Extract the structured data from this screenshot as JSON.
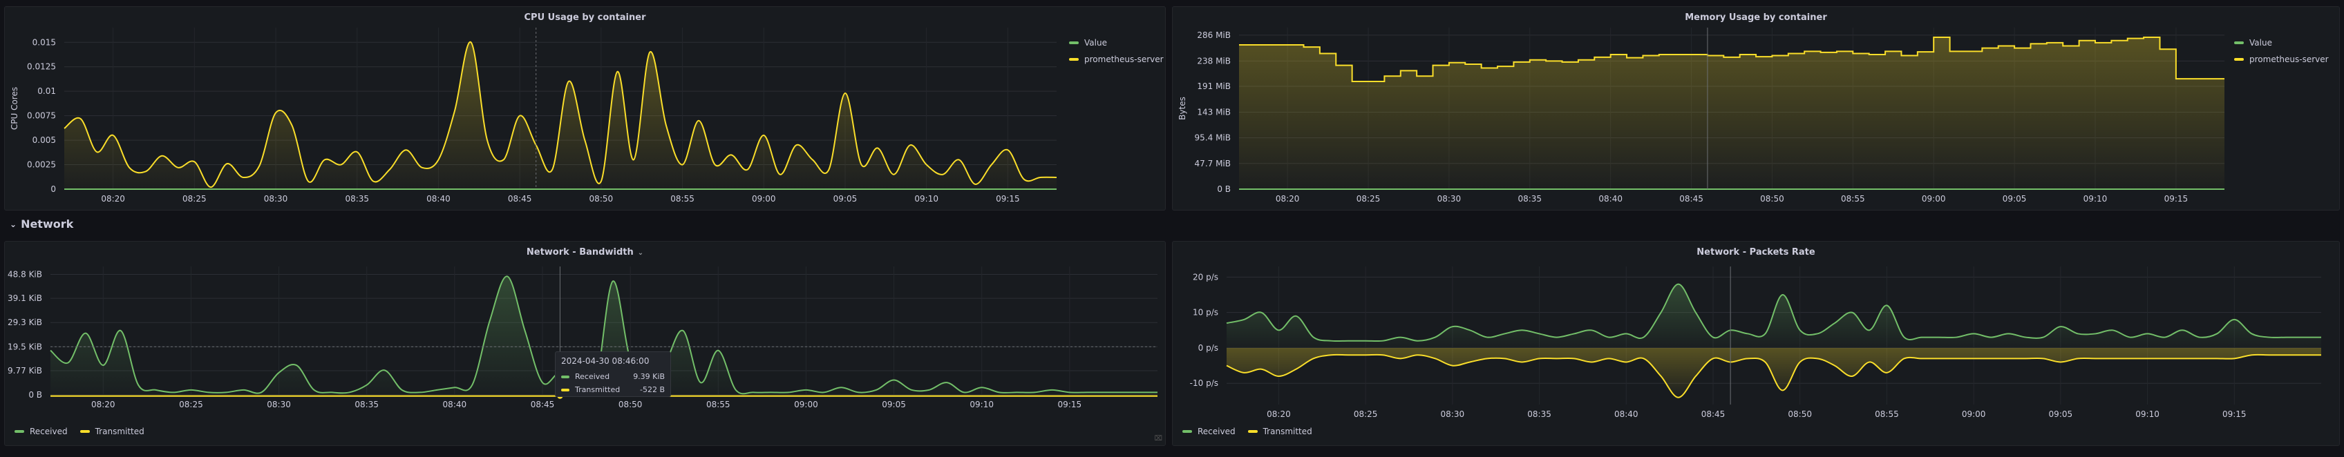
{
  "colors": {
    "green": "#73bf69",
    "yellow": "#fade2a",
    "background": "#111217",
    "panel": "#181b1f"
  },
  "network_row": {
    "title": "Network",
    "icon": "chevron-down-icon"
  },
  "chart_data": [
    {
      "id": "cpu",
      "type": "line",
      "title": "CPU Usage by container",
      "ylabel": "CPU Cores",
      "xticks": [
        "08:20",
        "08:25",
        "08:30",
        "08:35",
        "08:40",
        "08:45",
        "08:50",
        "08:55",
        "09:00",
        "09:05",
        "09:10",
        "09:15"
      ],
      "yticks": [
        "0",
        "0.0025",
        "0.005",
        "0.0075",
        "0.01",
        "0.0125",
        "0.015"
      ],
      "ylim": [
        0,
        0.0165
      ],
      "xlim": [
        "08:17",
        "09:18"
      ],
      "series": [
        {
          "name": "Value",
          "color": "#73bf69",
          "x": [
            "08:17",
            "09:18"
          ],
          "y": [
            0,
            0
          ]
        },
        {
          "name": "prometheus-server",
          "color": "#fade2a",
          "x": [
            "08:17",
            "08:18",
            "08:19",
            "08:20",
            "08:21",
            "08:22",
            "08:23",
            "08:24",
            "08:25",
            "08:26",
            "08:27",
            "08:28",
            "08:29",
            "08:30",
            "08:31",
            "08:32",
            "08:33",
            "08:34",
            "08:35",
            "08:36",
            "08:37",
            "08:38",
            "08:39",
            "08:40",
            "08:41",
            "08:42",
            "08:43",
            "08:44",
            "08:45",
            "08:46",
            "08:47",
            "08:48",
            "08:49",
            "08:50",
            "08:51",
            "08:52",
            "08:53",
            "08:54",
            "08:55",
            "08:56",
            "08:57",
            "08:58",
            "08:59",
            "09:00",
            "09:01",
            "09:02",
            "09:03",
            "09:04",
            "09:05",
            "09:06",
            "09:07",
            "09:08",
            "09:09",
            "09:10",
            "09:11",
            "09:12",
            "09:13",
            "09:14",
            "09:15",
            "09:16",
            "09:17",
            "09:18"
          ],
          "y": [
            0.0062,
            0.0072,
            0.0038,
            0.0055,
            0.0022,
            0.0018,
            0.0034,
            0.0022,
            0.0028,
            0.0002,
            0.0026,
            0.0012,
            0.0024,
            0.0078,
            0.0065,
            0.0008,
            0.003,
            0.0025,
            0.0038,
            0.0008,
            0.002,
            0.004,
            0.0022,
            0.003,
            0.008,
            0.015,
            0.005,
            0.003,
            0.0075,
            0.0045,
            0.002,
            0.011,
            0.005,
            0.0008,
            0.012,
            0.003,
            0.014,
            0.0065,
            0.0025,
            0.007,
            0.0025,
            0.0035,
            0.002,
            0.0055,
            0.0015,
            0.0045,
            0.003,
            0.002,
            0.0098,
            0.0025,
            0.0042,
            0.0015,
            0.0045,
            0.0025,
            0.0015,
            0.003,
            0.0005,
            0.0025,
            0.004,
            0.001,
            0.0012,
            0.0012
          ]
        }
      ],
      "legend": "right"
    },
    {
      "id": "mem",
      "type": "area",
      "title": "Memory Usage by container",
      "ylabel": "Bytes",
      "xticks": [
        "08:20",
        "08:25",
        "08:30",
        "08:35",
        "08:40",
        "08:45",
        "08:50",
        "08:55",
        "09:00",
        "09:05",
        "09:10",
        "09:15"
      ],
      "yticks": [
        "0 B",
        "47.7 MiB",
        "95.4 MiB",
        "143 MiB",
        "191 MiB",
        "238 MiB",
        "286 MiB"
      ],
      "ylim": [
        0,
        300
      ],
      "xlim": [
        "08:17",
        "09:18"
      ],
      "series": [
        {
          "name": "Value",
          "color": "#73bf69",
          "x": [
            "08:17",
            "09:18"
          ],
          "y": [
            0,
            0
          ]
        },
        {
          "name": "prometheus-server",
          "color": "#fade2a",
          "x": [
            "08:17",
            "08:20",
            "08:21",
            "08:22",
            "08:23",
            "08:24",
            "08:25",
            "08:26",
            "08:27",
            "08:28",
            "08:29",
            "08:30",
            "08:31",
            "08:32",
            "08:33",
            "08:34",
            "08:35",
            "08:36",
            "08:37",
            "08:38",
            "08:39",
            "08:40",
            "08:41",
            "08:42",
            "08:43",
            "08:44",
            "08:45",
            "08:46",
            "08:47",
            "08:48",
            "08:49",
            "08:50",
            "08:51",
            "08:52",
            "08:53",
            "08:54",
            "08:55",
            "08:56",
            "08:57",
            "08:58",
            "08:59",
            "09:00",
            "09:01",
            "09:02",
            "09:03",
            "09:04",
            "09:05",
            "09:06",
            "09:07",
            "09:08",
            "09:09",
            "09:10",
            "09:11",
            "09:12",
            "09:13",
            "09:14",
            "09:15",
            "09:18"
          ],
          "y": [
            268,
            268,
            264,
            252,
            230,
            200,
            200,
            210,
            220,
            210,
            230,
            235,
            232,
            225,
            228,
            236,
            240,
            238,
            236,
            240,
            245,
            250,
            244,
            248,
            250,
            250,
            250,
            248,
            245,
            250,
            246,
            248,
            252,
            256,
            254,
            256,
            252,
            250,
            256,
            248,
            255,
            282,
            256,
            256,
            262,
            266,
            262,
            270,
            272,
            266,
            276,
            272,
            276,
            280,
            282,
            260,
            205,
            205
          ]
        }
      ],
      "legend": "right"
    },
    {
      "id": "bw",
      "type": "area",
      "title": "Network - Bandwidth",
      "xticks": [
        "08:20",
        "08:25",
        "08:30",
        "08:35",
        "08:40",
        "08:45",
        "08:50",
        "08:55",
        "09:00",
        "09:05",
        "09:10",
        "09:15"
      ],
      "yticks": [
        "0 B",
        "9.77 KiB",
        "19.5 KiB",
        "29.3 KiB",
        "39.1 KiB",
        "48.8 KiB"
      ],
      "ylim": [
        0,
        52
      ],
      "xlim": [
        "08:17",
        "09:20"
      ],
      "series": [
        {
          "name": "Received",
          "color": "#73bf69",
          "x": [
            "08:17",
            "08:18",
            "08:19",
            "08:20",
            "08:21",
            "08:22",
            "08:23",
            "08:24",
            "08:25",
            "08:26",
            "08:27",
            "08:28",
            "08:29",
            "08:30",
            "08:31",
            "08:32",
            "08:33",
            "08:34",
            "08:35",
            "08:36",
            "08:37",
            "08:38",
            "08:39",
            "08:40",
            "08:41",
            "08:42",
            "08:43",
            "08:44",
            "08:45",
            "08:46",
            "08:47",
            "08:48",
            "08:49",
            "08:50",
            "08:51",
            "08:52",
            "08:53",
            "08:54",
            "08:55",
            "08:56",
            "08:57",
            "08:58",
            "08:59",
            "09:00",
            "09:01",
            "09:02",
            "09:03",
            "09:04",
            "09:05",
            "09:06",
            "09:07",
            "09:08",
            "09:09",
            "09:10",
            "09:11",
            "09:12",
            "09:13",
            "09:14",
            "09:15",
            "09:16",
            "09:17",
            "09:18",
            "09:19",
            "09:20"
          ],
          "y": [
            18,
            13,
            25,
            12,
            26,
            4,
            2,
            1,
            2,
            1,
            1,
            2,
            1,
            9,
            12,
            2,
            1,
            1,
            4,
            10,
            2,
            1,
            2,
            3,
            4,
            30,
            48,
            26,
            5,
            9,
            4,
            3,
            46,
            14,
            3,
            13,
            26,
            5,
            18,
            2,
            1,
            1,
            1,
            2,
            1,
            3,
            1,
            2,
            6,
            2,
            2,
            5,
            1,
            3,
            1,
            1,
            1,
            2,
            1,
            1,
            1,
            1,
            1,
            1
          ]
        },
        {
          "name": "Transmitted",
          "color": "#fade2a",
          "x": [
            "08:17",
            "09:20"
          ],
          "y": [
            -0.5,
            -0.5
          ]
        }
      ],
      "legend": "bottom",
      "tooltip": {
        "time": "2024-04-30 08:46:00",
        "rows": [
          {
            "name": "Received",
            "value": "9.39 KiB"
          },
          {
            "name": "Transmitted",
            "value": "-522 B"
          }
        ]
      }
    },
    {
      "id": "pkt",
      "type": "area",
      "title": "Network - Packets Rate",
      "xticks": [
        "08:20",
        "08:25",
        "08:30",
        "08:35",
        "08:40",
        "08:45",
        "08:50",
        "08:55",
        "09:00",
        "09:05",
        "09:10",
        "09:15"
      ],
      "yticks": [
        "-10 p/s",
        "0 p/s",
        "10 p/s",
        "20 p/s"
      ],
      "ylim": [
        -16,
        23
      ],
      "xlim": [
        "08:17",
        "09:20"
      ],
      "series": [
        {
          "name": "Received",
          "color": "#73bf69",
          "x": [
            "08:17",
            "08:18",
            "08:19",
            "08:20",
            "08:21",
            "08:22",
            "08:23",
            "08:24",
            "08:25",
            "08:26",
            "08:27",
            "08:28",
            "08:29",
            "08:30",
            "08:31",
            "08:32",
            "08:33",
            "08:34",
            "08:35",
            "08:36",
            "08:37",
            "08:38",
            "08:39",
            "08:40",
            "08:41",
            "08:42",
            "08:43",
            "08:44",
            "08:45",
            "08:46",
            "08:47",
            "08:48",
            "08:49",
            "08:50",
            "08:51",
            "08:52",
            "08:53",
            "08:54",
            "08:55",
            "08:56",
            "08:57",
            "08:58",
            "08:59",
            "09:00",
            "09:01",
            "09:02",
            "09:03",
            "09:04",
            "09:05",
            "09:06",
            "09:07",
            "09:08",
            "09:09",
            "09:10",
            "09:11",
            "09:12",
            "09:13",
            "09:14",
            "09:15",
            "09:16",
            "09:17",
            "09:18",
            "09:19",
            "09:20"
          ],
          "y": [
            7,
            8,
            10,
            5,
            9,
            3,
            2,
            2,
            2,
            2,
            3,
            2,
            3,
            6,
            5,
            3,
            4,
            5,
            4,
            3,
            4,
            5,
            3,
            4,
            3,
            10,
            18,
            10,
            3,
            5,
            4,
            4,
            15,
            5,
            4,
            7,
            10,
            5,
            12,
            3,
            3,
            3,
            3,
            4,
            3,
            4,
            3,
            3,
            6,
            4,
            4,
            5,
            3,
            4,
            3,
            5,
            3,
            4,
            8,
            4,
            3,
            3,
            3,
            3
          ]
        },
        {
          "name": "Transmitted",
          "color": "#fade2a",
          "x": [
            "08:17",
            "08:18",
            "08:19",
            "08:20",
            "08:21",
            "08:22",
            "08:23",
            "08:24",
            "08:25",
            "08:26",
            "08:27",
            "08:28",
            "08:29",
            "08:30",
            "08:31",
            "08:32",
            "08:33",
            "08:34",
            "08:35",
            "08:36",
            "08:37",
            "08:38",
            "08:39",
            "08:40",
            "08:41",
            "08:42",
            "08:43",
            "08:44",
            "08:45",
            "08:46",
            "08:47",
            "08:48",
            "08:49",
            "08:50",
            "08:51",
            "08:52",
            "08:53",
            "08:54",
            "08:55",
            "08:56",
            "08:57",
            "08:58",
            "08:59",
            "09:00",
            "09:01",
            "09:02",
            "09:03",
            "09:04",
            "09:05",
            "09:06",
            "09:07",
            "09:08",
            "09:09",
            "09:10",
            "09:11",
            "09:12",
            "09:13",
            "09:14",
            "09:15",
            "09:16",
            "09:17",
            "09:18",
            "09:19",
            "09:20"
          ],
          "y": [
            -5,
            -7,
            -6,
            -8,
            -6,
            -3,
            -2,
            -2,
            -2,
            -2,
            -3,
            -2,
            -3,
            -5,
            -4,
            -3,
            -3,
            -4,
            -3,
            -3,
            -3,
            -4,
            -3,
            -4,
            -3,
            -8,
            -14,
            -8,
            -3,
            -4,
            -3,
            -4,
            -12,
            -4,
            -3,
            -5,
            -8,
            -4,
            -7,
            -3,
            -3,
            -3,
            -3,
            -3,
            -3,
            -3,
            -3,
            -3,
            -4,
            -3,
            -3,
            -3,
            -3,
            -3,
            -3,
            -3,
            -3,
            -3,
            -3,
            -2,
            -2,
            -2,
            -2,
            -2
          ]
        }
      ],
      "legend": "bottom"
    }
  ]
}
